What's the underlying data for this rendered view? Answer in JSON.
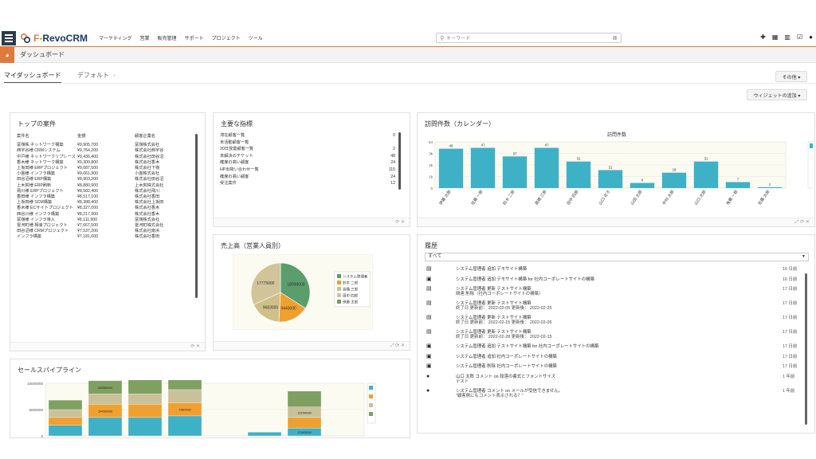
{
  "app": {
    "logo_prefix": "F-",
    "logo_name": "RevoCRM"
  },
  "nav": [
    "マーケティング",
    "営業",
    "販売管理",
    "サポート",
    "プロジェクト",
    "ツール"
  ],
  "search": {
    "placeholder": "キーワード"
  },
  "module": {
    "title": "ダッシュボード"
  },
  "tabs": [
    {
      "label": "マイダッシュボード",
      "active": true
    },
    {
      "label": "デフォルト",
      "close": "×"
    }
  ],
  "buttons": {
    "more": "その他 ▾",
    "add_widget": "ウィジェットの追加 ▾"
  },
  "top_deals": {
    "title": "トップの案件",
    "columns": [
      "案件名",
      "金額",
      "顧客企業名"
    ],
    "rows": [
      [
        "冨嶺株 ネットワーク構築",
        "¥9,905,700",
        "冨嶺株式会社"
      ],
      [
        "西宇谷様 CRMシステム",
        "¥9,764,200",
        "株式会社西宇谷"
      ],
      [
        "中戸様 ネットワークリプレース",
        "¥9,436,400",
        "株式会社田谷沼"
      ],
      [
        "香木様 ネットワーク構築",
        "¥9,300,800",
        "株式会社香木"
      ],
      [
        "上坂田様 ERPプロジェクト",
        "¥9,087,500",
        "株式会社下嶺"
      ],
      [
        "小畳様 インフラ構築",
        "¥9,061,900",
        "小畳株式会社"
      ],
      [
        "田谷沼様 ERP構築",
        "¥8,903,200",
        "株式会社田谷沼"
      ],
      [
        "上木賀様 ERP刷新",
        "¥8,880,900",
        "上木賀株式会社"
      ],
      [
        "飛川様 ERPプロジェクト",
        "¥8,582,400",
        "株式会社飛川"
      ],
      [
        "香田様 インフラ構築",
        "¥8,517,100",
        "株式会社香田"
      ],
      [
        "上坂田様 SCM構築",
        "¥8,388,400",
        "株式会社上坂田"
      ],
      [
        "香木様 ECサイトプロジェクト",
        "¥8,327,000",
        "株式会社香木"
      ],
      [
        "西谷川様 インフラ構築",
        "¥8,217,900",
        "株式会社香木"
      ],
      [
        "冨嶺様 インフラ導入",
        "¥8,111,900",
        "冨嶺株式会社"
      ],
      [
        "霊河町様 相浪プロジェクト",
        "¥7,667,500",
        "霊河町株式会社"
      ],
      [
        "田谷沼様 CRMプロジェクト",
        "¥7,537,200",
        "株式会社南浜"
      ],
      [
        "インフラ構築",
        "¥7,181,600",
        "株式会社香田"
      ]
    ]
  },
  "key_metrics": {
    "title": "主要な指標",
    "rows": [
      [
        "滞在顧客一覧",
        "0"
      ],
      [
        "未活動顧客一覧",
        ""
      ],
      [
        "30日放置顧客一覧",
        "2"
      ],
      [
        "未解決のチケット",
        "48"
      ],
      [
        "確度の高い顧客",
        "24"
      ],
      [
        "HP出荷い合わせ一覧",
        "115"
      ],
      [
        "確度の高い顧客",
        "24"
      ],
      [
        "受注案件",
        "12"
      ]
    ]
  },
  "visits": {
    "title": "訪問件数（カレンダー）",
    "chart_title": "訪問件数"
  },
  "sales": {
    "title": "売上高（営業人員別）"
  },
  "history": {
    "title": "履歴",
    "filter": "すべて",
    "items": [
      {
        "icon": "clipboard",
        "lines": [
          "システム管理者 追加 デモサイト構築"
        ],
        "time": "16 日前"
      },
      {
        "icon": "briefcase",
        "lines": [
          "システム管理者 追加 デモサイト構築 for 社内コーポレートサイトの構築"
        ],
        "time": "16 日前"
      },
      {
        "icon": "clipboard",
        "lines": [
          "システム管理者 更新 テストサイト構築",
          "関連 削除（社内コーポレートサイトの構築）"
        ],
        "time": "17 日前"
      },
      {
        "icon": "clipboard",
        "lines": [
          "システム管理者 更新 テストサイト構築",
          "終了日 更新前： 2022-02-05 更新後： 2022-02-25"
        ],
        "time": "17 日前"
      },
      {
        "icon": "clipboard",
        "lines": [
          "システム管理者 更新 テストサイト構築",
          "終了日 更新前： 2022-02-15 更新後： 2022-02-05"
        ],
        "time": "17 日前"
      },
      {
        "icon": "clipboard",
        "lines": [
          "システム管理者 更新 テストサイト構築",
          "終了日 更新前： 2022-02-28 更新後： 2022-02-15"
        ],
        "time": "17 日前"
      },
      {
        "icon": "briefcase",
        "lines": [
          "システム管理者 追加 テストサイト構築 for 社内コーポレートサイトの構築"
        ],
        "time": "17 日前"
      },
      {
        "icon": "briefcase",
        "lines": [
          "システム管理者 追加 社内コーポレートサイトの構築"
        ],
        "time": "17 日前"
      },
      {
        "icon": "briefcase",
        "lines": [
          "システム管理者 削除 社内コーポレートサイトの構築"
        ],
        "time": "17 日前"
      },
      {
        "icon": "comment",
        "lines": [
          "山口 太郎 コメント on 段落の書式とフォントサイズ",
          "テスト"
        ],
        "time": "1 年前"
      },
      {
        "icon": "comment",
        "lines": [
          "システム管理者 コメント on メールが受信できません。",
          "\"顧客側にもコメント表示される？\""
        ],
        "time": "1 年前"
      }
    ]
  },
  "pipeline": {
    "title": "セールスパイプライン"
  },
  "chart_data": [
    {
      "type": "bar",
      "title": "訪問件数",
      "categories": [
        "伊藤 太郎",
        "佐藤 一郎",
        "鈴木 二郎",
        "高橋 三郎",
        "田中 四郎",
        "山口 花子",
        "山田 太郎",
        "中村 太郎",
        "山口 太郎",
        "後藤 一郎",
        "佐藤 太郎"
      ],
      "values": [
        46,
        47,
        37,
        47,
        31,
        21,
        6,
        18,
        31,
        7,
        1
      ],
      "ylim": [
        0,
        54
      ],
      "yticks": [
        "54",
        "3k",
        "2k",
        "1k",
        "0"
      ],
      "color": "#3fb1c6"
    },
    {
      "type": "pie",
      "values": [
        18999000,
        9443000,
        9683000,
        17775000
      ],
      "labels": [
        "18999000",
        "9443000",
        "9683000",
        "17775000"
      ],
      "legend": [
        "システム管理者",
        "鈴木 二郎",
        "高橋 三郎",
        "田中 四郎",
        "伊藤 太郎"
      ],
      "colors": [
        "#5a9e6e",
        "#f0a030",
        "#cfc08a",
        "#d2c49a",
        "#6aa060"
      ]
    },
    {
      "type": "bar",
      "stacked": true,
      "ylim": [
        0,
        10000000
      ],
      "yticks": [
        "10000000",
        "5000000",
        "0"
      ],
      "columns": [
        {
          "segments": [
            2000000,
            1500000,
            1500000,
            1800000
          ],
          "labels": [
            "",
            "",
            "",
            ""
          ]
        },
        {
          "segments": [
            3500000,
            2500000,
            2000000,
            2500000
          ],
          "labels": [
            "",
            "14492000",
            "",
            "26390000"
          ]
        },
        {
          "segments": [
            3500000,
            2500000,
            2000000,
            3000000
          ],
          "labels": [
            "",
            "",
            "",
            ""
          ]
        },
        {
          "segments": [
            3800000,
            2500000,
            2500000,
            2600000
          ],
          "labels": [
            "",
            "7367000",
            "",
            ""
          ]
        },
        {
          "segments": [
            0,
            0,
            0,
            0
          ],
          "labels": [
            "",
            "",
            "",
            ""
          ]
        },
        {
          "segments": [
            700000,
            0,
            0,
            0
          ],
          "labels": [
            "",
            "",
            "",
            ""
          ]
        },
        {
          "segments": [
            1500000,
            2000000,
            2000000,
            3000000
          ],
          "labels": [
            "17493000",
            "",
            "16790000",
            ""
          ]
        },
        {
          "segments": [
            0,
            0,
            0,
            0
          ],
          "labels": [
            "",
            "",
            "",
            ""
          ]
        }
      ],
      "colors": [
        "#3fb1c6",
        "#f0a030",
        "#c9c19a",
        "#7fa060"
      ]
    }
  ]
}
